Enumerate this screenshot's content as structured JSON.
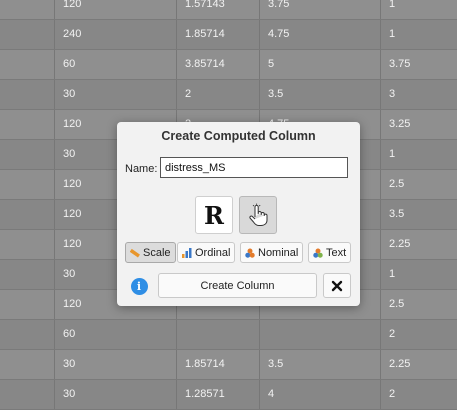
{
  "grid": {
    "rows": [
      [
        "",
        "120",
        "1.57143",
        "3.75",
        "1"
      ],
      [
        "",
        "240",
        "1.85714",
        "4.75",
        "1"
      ],
      [
        "",
        "60",
        "3.85714",
        "5",
        "3.75"
      ],
      [
        "",
        "30",
        "2",
        "3.5",
        "3"
      ],
      [
        "",
        "120",
        "2",
        "4.75",
        "3.25"
      ],
      [
        "",
        "30",
        "",
        "",
        "1"
      ],
      [
        "",
        "120",
        "",
        "",
        "2.5"
      ],
      [
        "",
        "120",
        "",
        "",
        "3.5"
      ],
      [
        "",
        "120",
        "",
        "",
        "2.25"
      ],
      [
        "",
        "30",
        "",
        "",
        "1"
      ],
      [
        "",
        "120",
        "",
        "",
        "2.5"
      ],
      [
        "",
        "60",
        "",
        "",
        "2"
      ],
      [
        "",
        "30",
        "1.85714",
        "3.5",
        "2.25"
      ],
      [
        "",
        "30",
        "1.28571",
        "4",
        "2"
      ]
    ]
  },
  "dialog": {
    "title": "Create Computed Column",
    "name_label": "Name:",
    "name_value": "distress_MS",
    "r_label": "R",
    "types": [
      {
        "label": "Scale",
        "icon": "ruler-icon",
        "active": true
      },
      {
        "label": "Ordinal",
        "icon": "bar-chart-icon",
        "active": false
      },
      {
        "label": "Nominal",
        "icon": "nominal-icon",
        "active": false
      },
      {
        "label": "Text",
        "icon": "text-icon",
        "active": false
      }
    ],
    "info_label": "i",
    "create_label": "Create Column",
    "close_label": "✕"
  },
  "colors": {
    "info_blue": "#2f8ee5",
    "scale_orange": "#e8962c",
    "ordinal_blue": "#3a78c8",
    "nominal_orange": "#e37b2b"
  }
}
